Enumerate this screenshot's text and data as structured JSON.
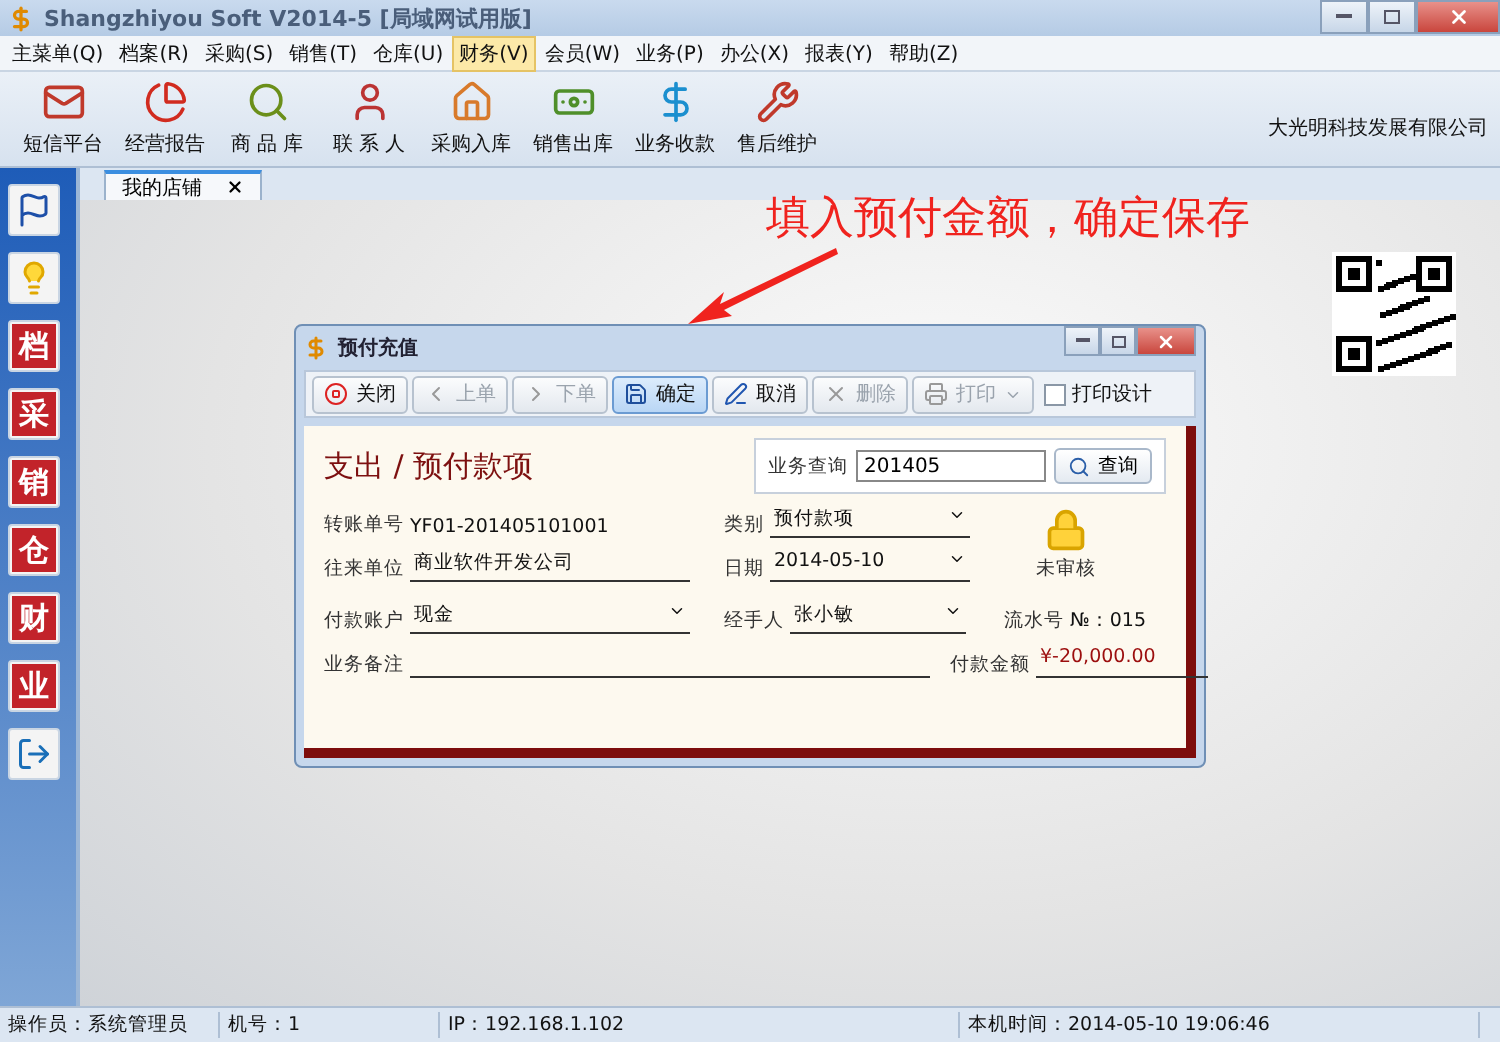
{
  "window": {
    "title": "Shangzhiyou Soft V2014-5 [局域网试用版]"
  },
  "menu": [
    {
      "label": "主菜单(Q)",
      "selected": false
    },
    {
      "label": "档案(R)",
      "selected": false
    },
    {
      "label": "采购(S)",
      "selected": false
    },
    {
      "label": "销售(T)",
      "selected": false
    },
    {
      "label": "仓库(U)",
      "selected": false
    },
    {
      "label": "财务(V)",
      "selected": true
    },
    {
      "label": "会员(W)",
      "selected": false
    },
    {
      "label": "业务(P)",
      "selected": false
    },
    {
      "label": "办公(X)",
      "selected": false
    },
    {
      "label": "报表(Y)",
      "selected": false
    },
    {
      "label": "帮助(Z)",
      "selected": false
    }
  ],
  "toolbar": [
    {
      "kind": "mail",
      "label": "短信平台"
    },
    {
      "kind": "chart",
      "label": "经营报告"
    },
    {
      "kind": "search",
      "label": "商 品 库"
    },
    {
      "kind": "person",
      "label": "联 系 人"
    },
    {
      "kind": "house",
      "label": "采购入库"
    },
    {
      "kind": "money",
      "label": "销售出库"
    },
    {
      "kind": "dollar",
      "label": "业务收款"
    },
    {
      "kind": "tools",
      "label": "售后维护"
    }
  ],
  "company": "大光明科技发展有限公司",
  "sidebar": [
    {
      "kind": "flag"
    },
    {
      "kind": "bulb"
    },
    {
      "kind": "char",
      "label": "档"
    },
    {
      "kind": "char",
      "label": "采"
    },
    {
      "kind": "char",
      "label": "销"
    },
    {
      "kind": "char",
      "label": "仓"
    },
    {
      "kind": "char",
      "label": "财"
    },
    {
      "kind": "char",
      "label": "业"
    },
    {
      "kind": "exit"
    }
  ],
  "tabs": [
    {
      "label": "我的店铺",
      "selected": true
    }
  ],
  "annotation": "填入预付金额，确定保存",
  "dialog": {
    "title": "预付充值",
    "buttons": [
      {
        "kind": "stop",
        "label": "关闭",
        "disabled": false,
        "selected": false
      },
      {
        "kind": "prev",
        "label": "上单",
        "disabled": true,
        "selected": false
      },
      {
        "kind": "next",
        "label": "下单",
        "disabled": true,
        "selected": false
      },
      {
        "kind": "save",
        "label": "确定",
        "disabled": false,
        "selected": true
      },
      {
        "kind": "pen",
        "label": "取消",
        "disabled": false,
        "selected": false
      },
      {
        "kind": "delete",
        "label": "删除",
        "disabled": true,
        "selected": false
      },
      {
        "kind": "print",
        "label": "打印",
        "disabled": true,
        "selected": false
      }
    ],
    "print_design": {
      "label": "打印设计",
      "checked": false
    },
    "heading": "支出 / 预付款项",
    "query": {
      "label": "业务查询",
      "value": "201405",
      "button": "查询"
    },
    "voucher_no": {
      "label": "转账单号",
      "value": "YF01-201405101001"
    },
    "category": {
      "label": "类别",
      "value": "预付款项"
    },
    "partner": {
      "label": "往来单位",
      "value": "商业软件开发公司"
    },
    "date": {
      "label": "日期",
      "value": "2014-05-10"
    },
    "audit": {
      "label": "未审核"
    },
    "account": {
      "label": "付款账户",
      "value": "现金"
    },
    "handler": {
      "label": "经手人",
      "value": "张小敏"
    },
    "serial": {
      "label": "流水号",
      "value": "№：015"
    },
    "remark": {
      "label": "业务备注"
    },
    "amount": {
      "label": "付款金额",
      "value": "¥-20,000.00"
    }
  },
  "status_bar": [
    "操作员：系统管理员",
    "机号：1",
    "IP：192.168.1.102",
    "本机时间：2014-05-10 19:06:46"
  ]
}
